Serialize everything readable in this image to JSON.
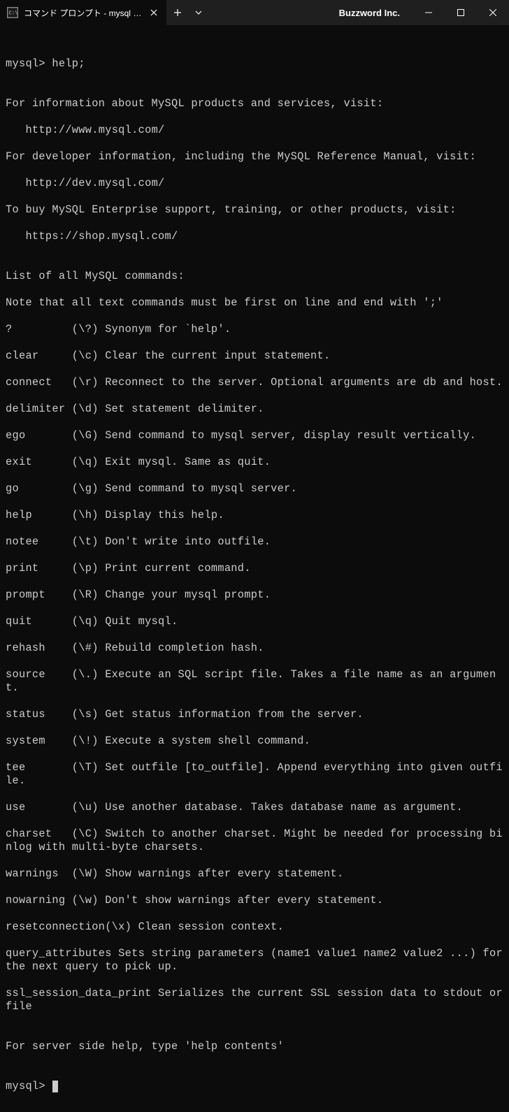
{
  "titlebar": {
    "tab_title": "コマンド プロンプト - mysql  -u roo",
    "app_name": "Buzzword Inc."
  },
  "terminal": {
    "prompt1": "mysql> help;",
    "blank": "",
    "info1": "For information about MySQL products and services, visit:",
    "info2": "   http://www.mysql.com/",
    "info3": "For developer information, including the MySQL Reference Manual, visit:",
    "info4": "   http://dev.mysql.com/",
    "info5": "To buy MySQL Enterprise support, training, or other products, visit:",
    "info6": "   https://shop.mysql.com/",
    "listhdr": "List of all MySQL commands:",
    "listnote": "Note that all text commands must be first on line and end with ';'",
    "cmd_q": "?         (\\?) Synonym for `help'.",
    "cmd_clear": "clear     (\\c) Clear the current input statement.",
    "cmd_connect": "connect   (\\r) Reconnect to the server. Optional arguments are db and host.",
    "cmd_delimiter": "delimiter (\\d) Set statement delimiter.",
    "cmd_ego": "ego       (\\G) Send command to mysql server, display result vertically.",
    "cmd_exit": "exit      (\\q) Exit mysql. Same as quit.",
    "cmd_go": "go        (\\g) Send command to mysql server.",
    "cmd_help": "help      (\\h) Display this help.",
    "cmd_notee": "notee     (\\t) Don't write into outfile.",
    "cmd_print": "print     (\\p) Print current command.",
    "cmd_prompt": "prompt    (\\R) Change your mysql prompt.",
    "cmd_quit": "quit      (\\q) Quit mysql.",
    "cmd_rehash": "rehash    (\\#) Rebuild completion hash.",
    "cmd_source": "source    (\\.) Execute an SQL script file. Takes a file name as an argument.",
    "cmd_status": "status    (\\s) Get status information from the server.",
    "cmd_system": "system    (\\!) Execute a system shell command.",
    "cmd_tee": "tee       (\\T) Set outfile [to_outfile]. Append everything into given outfile.",
    "cmd_use": "use       (\\u) Use another database. Takes database name as argument.",
    "cmd_charset": "charset   (\\C) Switch to another charset. Might be needed for processing binlog with multi-byte charsets.",
    "cmd_warnings": "warnings  (\\W) Show warnings after every statement.",
    "cmd_nowarning": "nowarning (\\w) Don't show warnings after every statement.",
    "cmd_resetconn": "resetconnection(\\x) Clean session context.",
    "cmd_queryattr": "query_attributes Sets string parameters (name1 value1 name2 value2 ...) for the next query to pick up.",
    "cmd_ssl": "ssl_session_data_print Serializes the current SSL session data to stdout or file",
    "footer": "For server side help, type 'help contents'",
    "prompt2": "mysql> "
  }
}
